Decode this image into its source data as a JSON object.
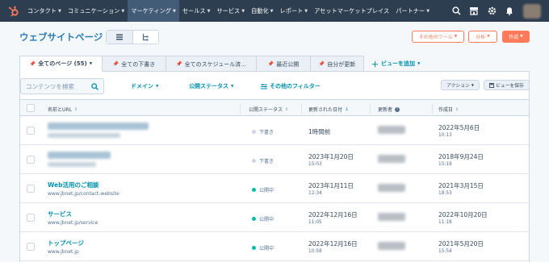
{
  "nav": {
    "items": [
      {
        "label": "コンタクト",
        "active": false
      },
      {
        "label": "コミュニケーション",
        "active": false
      },
      {
        "label": "マーケティング",
        "active": true
      },
      {
        "label": "セールス",
        "active": false
      },
      {
        "label": "サービス",
        "active": false
      },
      {
        "label": "自動化",
        "active": false
      },
      {
        "label": "レポート",
        "active": false
      },
      {
        "label": "アセットマーケットプレイス",
        "active": false
      },
      {
        "label": "パートナー",
        "active": false
      }
    ],
    "icons": [
      "search-icon",
      "marketplace-icon",
      "settings-icon",
      "notifications-icon"
    ]
  },
  "header": {
    "title": "ウェブサイトページ",
    "other_tools_label": "その他のツール",
    "analytics_label": "分析",
    "create_label": "作成"
  },
  "tabs": {
    "items": [
      {
        "label": "全てのページ (55)",
        "active": true
      },
      {
        "label": "全ての下書き",
        "active": false
      },
      {
        "label": "全てのスケジュール済...",
        "active": false
      },
      {
        "label": "最近公開",
        "active": false
      },
      {
        "label": "自分が更新",
        "active": false
      }
    ],
    "add_view_label": "ビューを追加"
  },
  "filters": {
    "search_placeholder": "コンテンツを検索",
    "domain_label": "ドメイン",
    "status_label": "公開ステータス",
    "more_filters_label": "その他のフィルター",
    "actions_label": "アクション",
    "save_view_label": "ビューを保存"
  },
  "table": {
    "headers": {
      "name": "名前とURL",
      "status": "公開ステータス",
      "updated": "更新された日付",
      "updater": "更新者",
      "created": "作成日"
    },
    "rows": [
      {
        "name": "",
        "url": "",
        "status": "下書き",
        "published": false,
        "updated_date": "1時間前",
        "updated_time": "",
        "created_date": "2022年5月6日",
        "created_time": "10:13"
      },
      {
        "name": "",
        "url": "",
        "status": "下書き",
        "published": false,
        "updated_date": "2023年1月20日",
        "updated_time": "15:03",
        "created_date": "2018年9月24日",
        "created_time": "15:19"
      },
      {
        "name": "Web活用のご相談",
        "url": "www.jbnet.jp/contact-website",
        "status": "公開中",
        "published": true,
        "updated_date": "2023年1月11日",
        "updated_time": "12:34",
        "created_date": "2021年3月15日",
        "created_time": "18:53"
      },
      {
        "name": "サービス",
        "url": "www.jbnet.jp/service",
        "status": "公開中",
        "published": true,
        "updated_date": "2022年12月16日",
        "updated_time": "11:05",
        "created_date": "2022年10月20日",
        "created_time": "11:18"
      },
      {
        "name": "トップページ",
        "url": "www.jbnet.jp",
        "status": "公開中",
        "published": true,
        "updated_date": "2022年12月16日",
        "updated_time": "10:58",
        "created_date": "2021年5月20日",
        "created_time": "15:54"
      }
    ]
  },
  "colors": {
    "nav_bg": "#2d3e50",
    "accent": "#ff7a59",
    "link": "#0091ae",
    "published": "#00bda5",
    "draft": "#cbd6e2"
  }
}
